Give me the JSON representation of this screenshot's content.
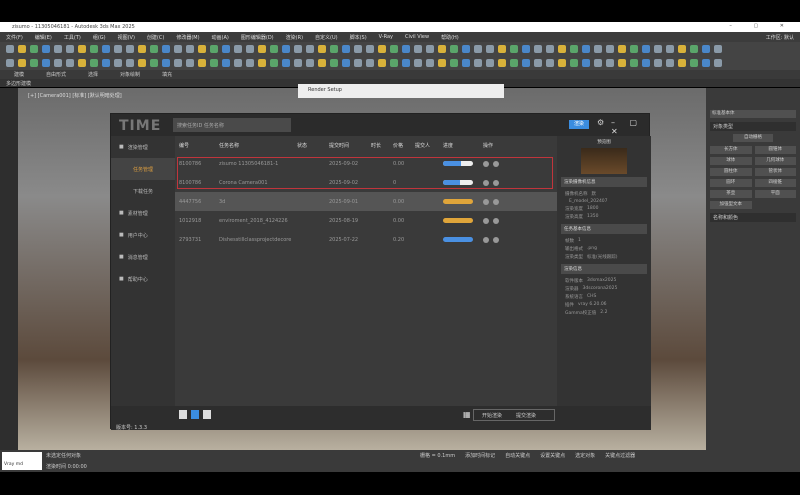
{
  "app": {
    "title": "zisumo - 11305046181 - Autodesk 3ds Max 2025",
    "window_controls": "– ▢ ✕"
  },
  "menu": [
    "文件(F)",
    "编辑(E)",
    "工具(T)",
    "组(G)",
    "视图(V)",
    "创建(C)",
    "修改器(M)",
    "动画(A)",
    "图形编辑器(D)",
    "渲染(R)",
    "自定义(U)",
    "脚本(S)",
    "V-Ray",
    "Civil View",
    "帮助(H)"
  ],
  "workspace": "工作区: 默认",
  "ribbon": [
    "建模",
    "自由形式",
    "选择",
    "对象绘制",
    "填充"
  ],
  "ribbon_sub": "多边形建模",
  "viewport_label": "[+] [Camera001] [标准] [默认明暗处理]",
  "render_setup_title": "Render Setup",
  "right_panel": {
    "dropdown": "标准基本体",
    "section1": "对象类型",
    "auto_grid": "自动栅格",
    "buttons": [
      "长方体",
      "圆锥体",
      "球体",
      "几何球体",
      "圆柱体",
      "管状体",
      "圆环",
      "四棱锥",
      "茶壶",
      "平面",
      "加强型文本"
    ],
    "section2": "名称和颜色"
  },
  "time_app": {
    "logo": "TIME",
    "search_placeholder": "搜索任务ID 任务名称",
    "render_button": "渲染",
    "settings_icon": "gear-icon",
    "nav": [
      {
        "label": "渲染管理",
        "icon": "render-icon"
      },
      {
        "label": "任务管理"
      },
      {
        "label": "下载任务"
      },
      {
        "label": "素材管理",
        "icon": "folder-icon"
      },
      {
        "label": "用户中心",
        "icon": "user-icon"
      },
      {
        "label": "消息管理",
        "icon": "message-icon"
      },
      {
        "label": "帮助中心",
        "icon": "help-icon"
      }
    ],
    "columns": [
      "编号",
      "任务名称",
      "状态",
      "提交时间",
      "时长",
      "价格",
      "提交人",
      "进度",
      "操作"
    ],
    "rows": [
      {
        "id": "8100786",
        "name": "zisumo 11305046181-1",
        "date": "2025-09-02",
        "price": "0.00",
        "progress": 60,
        "color": "#4a90e2"
      },
      {
        "id": "8100786",
        "name": "Corona Camera001",
        "date": "2025-09-02",
        "price": "0",
        "progress": 55,
        "color": "#4a90e2"
      },
      {
        "id": "4447756",
        "name": "3d",
        "date": "2025-09-01",
        "price": "0.00",
        "progress": 100,
        "color": "#e0a53a"
      },
      {
        "id": "1012918",
        "name": "enviroment_2018_4124226",
        "date": "2025-08-19",
        "price": "0.00",
        "progress": 100,
        "color": "#e0a53a"
      },
      {
        "id": "2793731",
        "name": "Dishesstillclassprojectdecore",
        "date": "2025-07-22",
        "price": "0.20",
        "progress": 100,
        "color": "#4a90e2"
      }
    ],
    "info": {
      "preview_title": "预览图",
      "camera_section": "渲染摄像机信息",
      "camera": [
        [
          "摄像机名称",
          "默"
        ],
        [
          "",
          "E_model_202407"
        ],
        [
          "渲染宽度",
          "1800"
        ],
        [
          "渲染高度",
          "1350"
        ]
      ],
      "task_section": "任务基本信息",
      "task": [
        [
          "帧数",
          "1"
        ],
        [
          "输出格式",
          ".png"
        ],
        [
          "渲染类型",
          "标准(光线跟踪)"
        ]
      ],
      "render_section": "渲染信息",
      "render": [
        [
          "软件版本",
          "3dsmax2025"
        ],
        [
          "渲染器",
          "3dscorona2025"
        ],
        [
          "系统语言",
          "CHS"
        ],
        [
          "插件",
          "vray 6.20.06"
        ],
        [
          "Gamma校正值",
          "2.2"
        ]
      ]
    },
    "pages": [
      "1",
      "2",
      "3"
    ],
    "footer_buttons": [
      "开始渲染",
      "提交渲染"
    ],
    "version": "版本号: 1.3.3"
  },
  "status": {
    "selection": "未选定任何对象",
    "render_time": "渲染时间  0:00:00",
    "maxscript": "Vray md",
    "grid": "栅格 = 0.1mm",
    "add_tag": "添加时间标记",
    "auto_key": "自动关键点",
    "set_key": "设置关键点",
    "selected": "选定对象",
    "key_filter": "关键点过滤器"
  }
}
